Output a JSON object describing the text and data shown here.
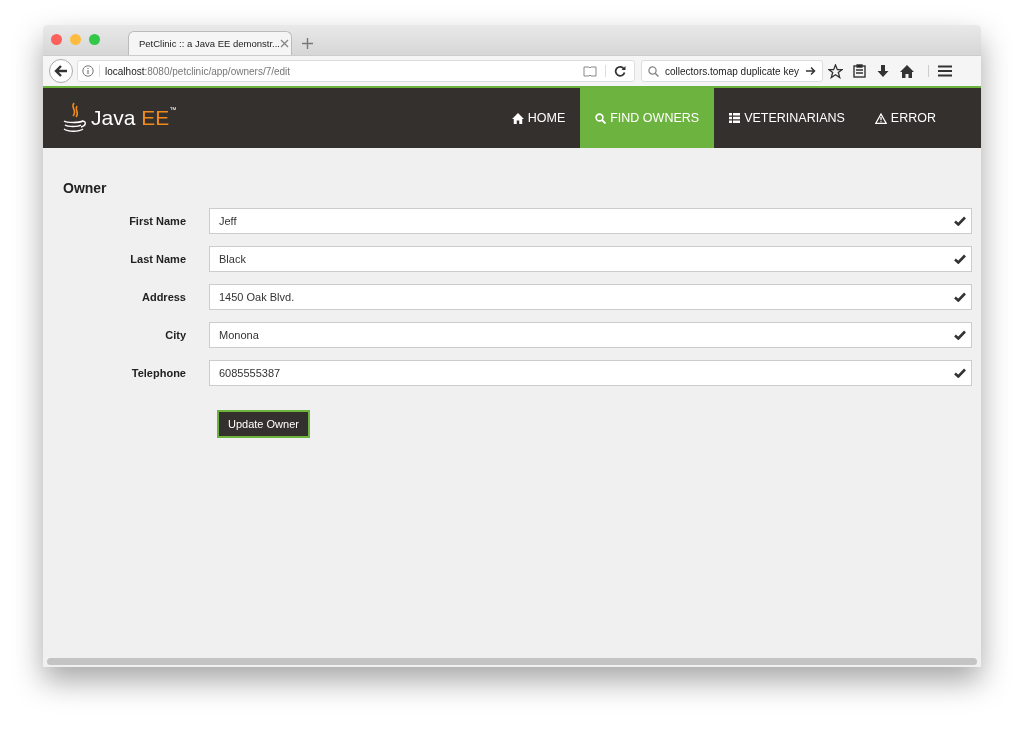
{
  "browser": {
    "tab_title": "PetClinic :: a Java EE demonstr...",
    "url_host": "localhost",
    "url_path": ":8080/petclinic/app/owners/7/edit",
    "search": "collectors.tomap duplicate key"
  },
  "navbar": {
    "brand": "Java",
    "brand_accent": "EE",
    "brand_mark": "™",
    "items": [
      {
        "label": "HOME",
        "selected": false
      },
      {
        "label": "FIND OWNERS",
        "selected": true
      },
      {
        "label": "VETERINARIANS",
        "selected": false
      },
      {
        "label": "ERROR",
        "selected": false
      }
    ]
  },
  "form": {
    "title": "Owner",
    "fields": [
      {
        "label": "First Name",
        "value": "Jeff",
        "valid": true
      },
      {
        "label": "Last Name",
        "value": "Black",
        "valid": true
      },
      {
        "label": "Address",
        "value": "1450 Oak Blvd.",
        "valid": true
      },
      {
        "label": "City",
        "value": "Monona",
        "valid": true
      },
      {
        "label": "Telephone",
        "value": "6085555387",
        "valid": true
      }
    ],
    "submit": "Update Owner"
  }
}
